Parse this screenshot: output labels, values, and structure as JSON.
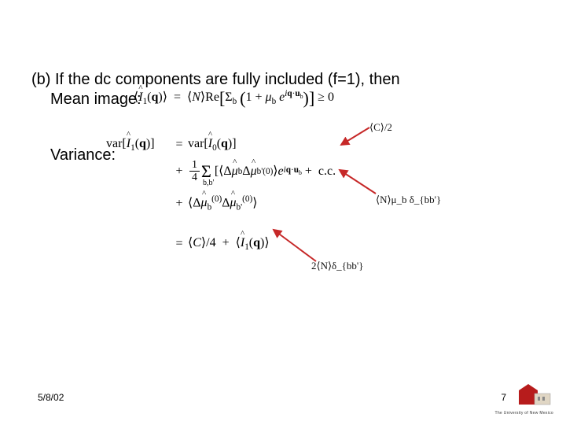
{
  "heading_b": "(b) If the dc components are fully included (f=1), then",
  "mean_label": "Mean image:",
  "variance_label": "Variance:",
  "formulas": {
    "mean": "⟨Î₁(q)⟩ = ⟨N⟩Re[Σ_b (1 + μ_b e^{iq·u_b})] ≥ 0",
    "var_line1_left": "var[Î₁(q)]",
    "var_line1_right": "var[Î₀(q)]",
    "var_line2": "¼ Σ_{b,b'} [⟨Δμ̂_b Δμ̂_{b'}^{(0)}⟩ e^{iq·u_b} + c.c.]",
    "var_line3": "⟨Δμ̂_b^{(0)} Δμ̂_{b'}^{(0)}⟩",
    "var_line4": "⟨C⟩/4 + ⟨Î₁(q)⟩",
    "annot1": "⟨C⟩/2",
    "annot2": "⟨N⟩μ_b δ_{bb'}",
    "annot3": "2⟨N⟩δ_{bb'}"
  },
  "footer": {
    "date": "5/8/02",
    "page": "7",
    "institution": "The University of New Mexico"
  }
}
